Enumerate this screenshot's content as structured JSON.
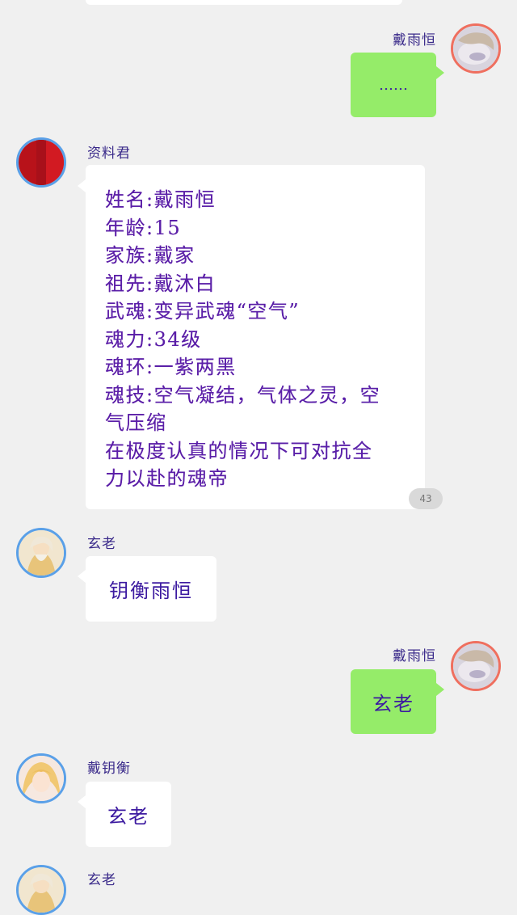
{
  "messages": [
    {
      "id": "m1",
      "side": "right",
      "sender": "戴雨恒",
      "text": "……",
      "avatar_icon": "sleeping-boy-avatar-icon"
    },
    {
      "id": "m2",
      "side": "left",
      "sender": "资料君",
      "avatar_icon": "red-circle-avatar-icon",
      "lines": [
        "姓名:戴雨恒",
        "年龄:15",
        "家族:戴家",
        "祖先:戴沐白",
        "武魂:变异武魂“空气”",
        "魂力:34级",
        "魂环:一紫两黑",
        "魂技:空气凝结，气体之灵，空",
        "气压缩",
        "在极度认真的情况下可对抗全",
        "力以赴的魂帝"
      ],
      "badge": "43"
    },
    {
      "id": "m3",
      "side": "left",
      "sender": "玄老",
      "text": "钥衡雨恒",
      "avatar_icon": "elder-avatar-icon"
    },
    {
      "id": "m4",
      "side": "right",
      "sender": "戴雨恒",
      "text": "玄老",
      "avatar_icon": "sleeping-boy-avatar-icon"
    },
    {
      "id": "m5",
      "side": "left",
      "sender": "戴钥衡",
      "text": "玄老",
      "avatar_icon": "blonde-boy-avatar-icon"
    },
    {
      "id": "m6",
      "side": "left",
      "sender": "玄老",
      "avatar_icon": "elder-avatar-icon"
    }
  ],
  "colors": {
    "background": "#f0f0f0",
    "bubble_self": "#95ec69",
    "bubble_other": "#ffffff",
    "text_primary": "#3c1aa0",
    "avatar_ring_left": "#5aa0e8",
    "avatar_ring_right": "#ef6f5f"
  }
}
